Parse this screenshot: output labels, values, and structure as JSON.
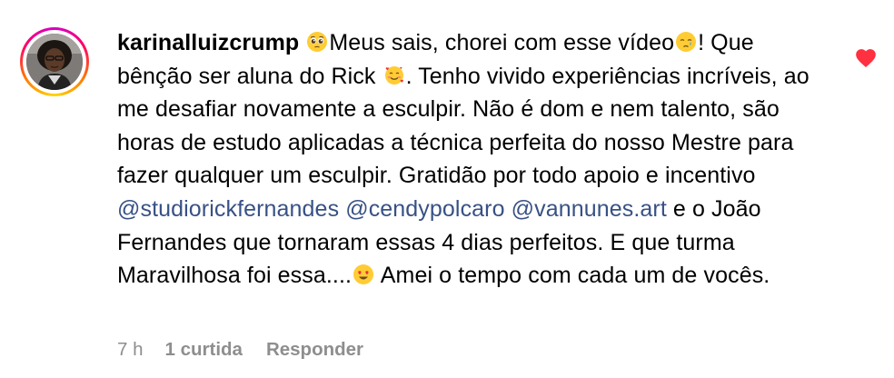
{
  "comment": {
    "username": "karinalluizcrump",
    "segments": [
      {
        "type": "emoji",
        "icon": "pleading-face-emoji"
      },
      {
        "type": "text",
        "text": "Meus sais, chorei com esse vídeo"
      },
      {
        "type": "emoji",
        "icon": "crying-face-emoji"
      },
      {
        "type": "text",
        "text": "! Que bênção ser aluna do Rick "
      },
      {
        "type": "emoji",
        "icon": "smiling-face-with-hearts-emoji"
      },
      {
        "type": "text",
        "text": ". Tenho vivido experiências incríveis, ao me desafiar novamente a esculpir. Não é dom e nem talento, são horas de estudo aplicadas a técnica perfeita do nosso Mestre para fazer qualquer um esculpir. Gratidão por todo apoio e incentivo "
      },
      {
        "type": "mention",
        "text": "@studiorickfernandes"
      },
      {
        "type": "text",
        "text": " "
      },
      {
        "type": "mention",
        "text": "@cendypolcaro"
      },
      {
        "type": "text",
        "text": " "
      },
      {
        "type": "mention",
        "text": "@vannunes.art"
      },
      {
        "type": "text",
        "text": " e o João Fernandes que tornaram essas 4 dias perfeitos. E que turma Maravilhosa foi essa...."
      },
      {
        "type": "emoji",
        "icon": "heart-eyes-emoji"
      },
      {
        "type": "text",
        "text": " Amei o tempo com cada um de vocês."
      }
    ],
    "time": "7 h",
    "likes": "1 curtida",
    "reply": "Responder",
    "liked": true
  },
  "colors": {
    "mention": "#385185",
    "meta": "#8e8e8e",
    "heart": "#ff3040"
  }
}
